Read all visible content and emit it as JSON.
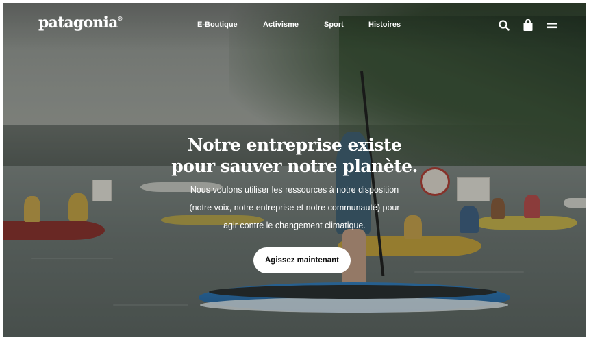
{
  "brand": {
    "logo_text": "patagonia",
    "logo_mark": "®"
  },
  "nav": {
    "items": [
      {
        "label": "E-Boutique"
      },
      {
        "label": "Activisme"
      },
      {
        "label": "Sport"
      },
      {
        "label": "Histoires"
      }
    ],
    "icons": [
      "search-icon",
      "shopping-bag-icon",
      "menu-icon"
    ]
  },
  "hero": {
    "title_lines": [
      "Notre entreprise existe",
      "pour sauver notre planète."
    ],
    "text_lines": [
      "Nous voulons utiliser les ressources à notre disposition",
      "(notre voix, notre entreprise et notre communauté) pour",
      "agir contre le changement climatique."
    ],
    "cta_label": "Agissez maintenant"
  },
  "colors": {
    "text": "#ffffff",
    "cta_background": "#ffffff",
    "cta_text": "#111111"
  }
}
